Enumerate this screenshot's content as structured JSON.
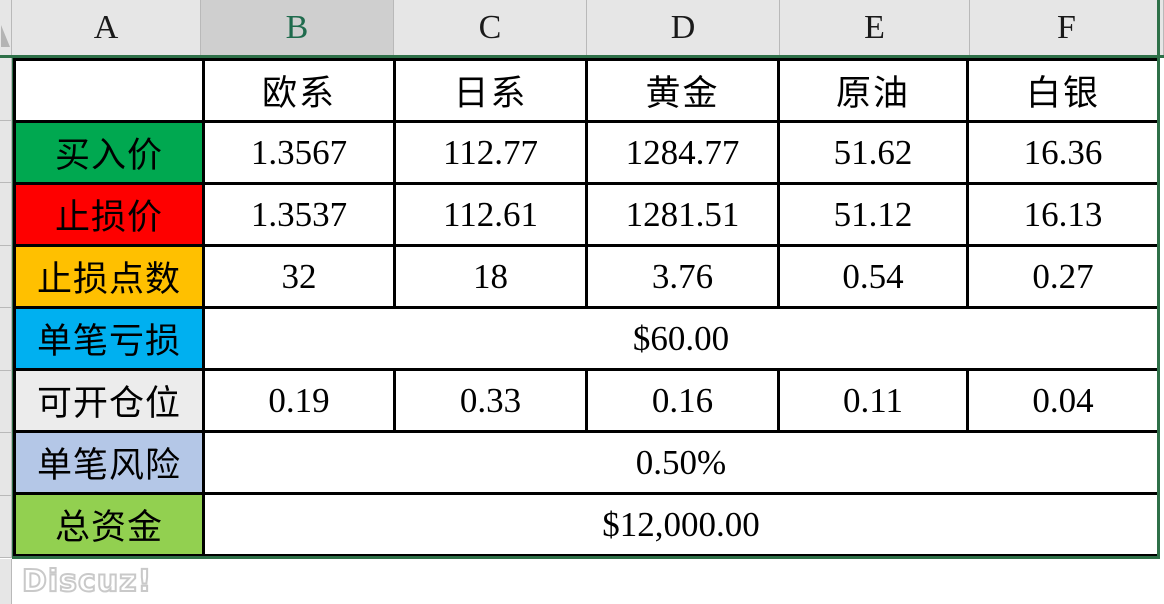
{
  "spreadsheet": {
    "column_headers": [
      "A",
      "B",
      "C",
      "D",
      "E",
      "F"
    ],
    "selected_column": "B",
    "corner_icon": "select-all-triangle-icon",
    "colors": {
      "header_text": "#c5590f",
      "row_buy": "#00a850",
      "row_stop": "#fe0000",
      "row_points": "#ffc000",
      "row_loss": "#00b0f0",
      "row_position": "#ececec",
      "row_risk": "#b4c7e7",
      "row_capital": "#92d050",
      "grid_accent": "#2e7048"
    },
    "header_row": {
      "corner": "",
      "instruments": [
        "欧系",
        "日系",
        "黄金",
        "原油",
        "白银"
      ]
    },
    "rows": [
      {
        "label": "买入价",
        "merged": false,
        "values": [
          "1.3567",
          "112.77",
          "1284.77",
          "51.62",
          "16.36"
        ]
      },
      {
        "label": "止损价",
        "merged": false,
        "values": [
          "1.3537",
          "112.61",
          "1281.51",
          "51.12",
          "16.13"
        ]
      },
      {
        "label": "止损点数",
        "merged": false,
        "values": [
          "32",
          "18",
          "3.76",
          "0.54",
          "0.27"
        ]
      },
      {
        "label": "单笔亏损",
        "merged": true,
        "merged_value": "$60.00",
        "values": []
      },
      {
        "label": "可开仓位",
        "merged": false,
        "values": [
          "0.19",
          "0.33",
          "0.16",
          "0.11",
          "0.04"
        ]
      },
      {
        "label": "单笔风险",
        "merged": true,
        "merged_value": "0.50%",
        "values": []
      },
      {
        "label": "总资金",
        "merged": true,
        "merged_value": "$12,000.00",
        "values": []
      }
    ]
  },
  "watermark": {
    "text": "Discuz!"
  }
}
